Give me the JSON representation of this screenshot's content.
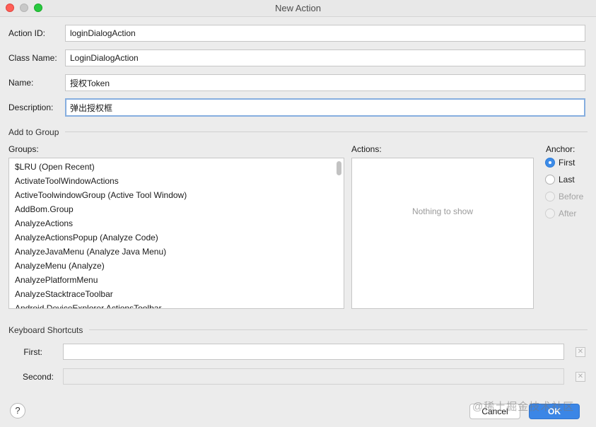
{
  "window": {
    "title": "New Action"
  },
  "form": {
    "action_id": {
      "label": "Action ID:",
      "value": "loginDialogAction"
    },
    "class_name": {
      "label": "Class Name:",
      "value": "LoginDialogAction"
    },
    "name": {
      "label": "Name:",
      "value": "授权Token"
    },
    "description": {
      "label": "Description:",
      "value": "弹出授权框"
    }
  },
  "add_to_group": {
    "title": "Add to Group",
    "groups_label": "Groups:",
    "groups": [
      "$LRU (Open Recent)",
      "ActivateToolWindowActions",
      "ActiveToolwindowGroup (Active Tool Window)",
      "AddBom.Group",
      "AnalyzeActions",
      "AnalyzeActionsPopup (Analyze Code)",
      "AnalyzeJavaMenu (Analyze Java Menu)",
      "AnalyzeMenu (Analyze)",
      "AnalyzePlatformMenu",
      "AnalyzeStacktraceToolbar",
      "Android.DeviceExplorer.ActionsToolbar"
    ],
    "actions_label": "Actions:",
    "actions_empty": "Nothing to show",
    "anchor_label": "Anchor:",
    "anchors": [
      {
        "label": "First",
        "checked": true,
        "enabled": true
      },
      {
        "label": "Last",
        "checked": false,
        "enabled": true
      },
      {
        "label": "Before",
        "checked": false,
        "enabled": false
      },
      {
        "label": "After",
        "checked": false,
        "enabled": false
      }
    ]
  },
  "keyboard_shortcuts": {
    "title": "Keyboard Shortcuts",
    "first_label": "First:",
    "second_label": "Second:"
  },
  "buttons": {
    "help": "?",
    "cancel": "Cancel",
    "ok": "OK"
  },
  "watermark": "@稀土掘金技术社区",
  "colors": {
    "accent": "#3b86e6",
    "focus_ring": "#86aedf"
  }
}
